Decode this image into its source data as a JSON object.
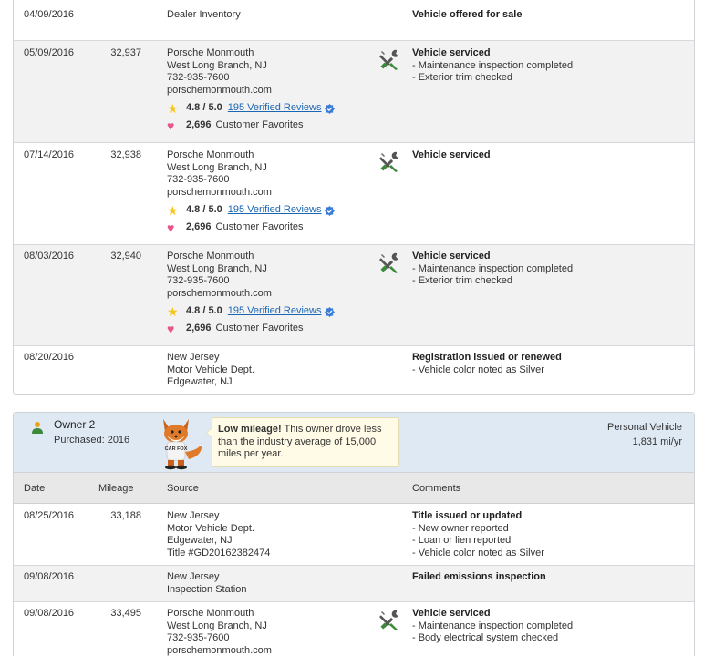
{
  "owner1": {
    "records": [
      {
        "date": "04/09/2016",
        "mileage": "",
        "source": [
          "Dealer Inventory"
        ],
        "comment_title": "Vehicle offered for sale",
        "comments": [],
        "serviced_icon": false
      },
      {
        "date": "05/09/2016",
        "mileage": "32,937",
        "source": [
          "Porsche Monmouth",
          "West Long Branch, NJ",
          "732-935-7600",
          "porschemonmouth.com"
        ],
        "rating": "4.8 / 5.0",
        "reviews": "195 Verified Reviews",
        "favorites": "2,696",
        "favorites_label": "Customer Favorites",
        "comment_title": "Vehicle serviced",
        "comments": [
          "- Maintenance inspection completed",
          "- Exterior trim checked"
        ],
        "serviced_icon": true
      },
      {
        "date": "07/14/2016",
        "mileage": "32,938",
        "source": [
          "Porsche Monmouth",
          "West Long Branch, NJ",
          "732-935-7600",
          "porschemonmouth.com"
        ],
        "rating": "4.8 / 5.0",
        "reviews": "195 Verified Reviews",
        "favorites": "2,696",
        "favorites_label": "Customer Favorites",
        "comment_title": "Vehicle serviced",
        "comments": [],
        "serviced_icon": true
      },
      {
        "date": "08/03/2016",
        "mileage": "32,940",
        "source": [
          "Porsche Monmouth",
          "West Long Branch, NJ",
          "732-935-7600",
          "porschemonmouth.com"
        ],
        "rating": "4.8 / 5.0",
        "reviews": "195 Verified Reviews",
        "favorites": "2,696",
        "favorites_label": "Customer Favorites",
        "comment_title": "Vehicle serviced",
        "comments": [
          "- Maintenance inspection completed",
          "- Exterior trim checked"
        ],
        "serviced_icon": true
      },
      {
        "date": "08/20/2016",
        "mileage": "",
        "source": [
          "New Jersey",
          "Motor Vehicle Dept.",
          "Edgewater, NJ"
        ],
        "comment_title": "Registration issued or renewed",
        "comments": [
          "- Vehicle color noted as Silver"
        ],
        "serviced_icon": false
      }
    ]
  },
  "owner2": {
    "name": "Owner 2",
    "purchased": "Purchased: 2016",
    "tip_bold": "Low mileage!",
    "tip_text": " This owner drove less than the industry average of 15,000 miles per year.",
    "vehicle_type": "Personal Vehicle",
    "miles_per_year": "1,831 mi/yr",
    "fox_shirt": "CAR FOX",
    "headers": {
      "date": "Date",
      "mileage": "Mileage",
      "source": "Source",
      "comments": "Comments"
    },
    "records": [
      {
        "date": "08/25/2016",
        "mileage": "33,188",
        "source": [
          "New Jersey",
          "Motor Vehicle Dept.",
          "Edgewater, NJ",
          "Title #GD20162382474"
        ],
        "comment_title": "Title issued or updated",
        "comments": [
          "- New owner reported",
          "- Loan or lien reported",
          "- Vehicle color noted as Silver"
        ],
        "serviced_icon": false
      },
      {
        "date": "09/08/2016",
        "mileage": "",
        "source": [
          "New Jersey",
          "Inspection Station"
        ],
        "comment_title": "Failed emissions inspection",
        "comments": [],
        "serviced_icon": false
      },
      {
        "date": "09/08/2016",
        "mileage": "33,495",
        "source": [
          "Porsche Monmouth",
          "West Long Branch, NJ",
          "732-935-7600",
          "porschemonmouth.com"
        ],
        "comment_title": "Vehicle serviced",
        "comments": [
          "- Maintenance inspection completed",
          "- Body electrical system checked"
        ],
        "serviced_icon": true
      }
    ]
  },
  "colors": {
    "link": "#1a66b3",
    "owner_header_bg": "#dfe9f4",
    "star": "#f5c518",
    "heart": "#e8548b",
    "wrench_green": "#3b8a3b"
  },
  "icons": [
    "wrench-screwdriver-icon",
    "star-icon",
    "heart-icon",
    "verified-badge-icon",
    "person-icon",
    "carfox-mascot"
  ]
}
